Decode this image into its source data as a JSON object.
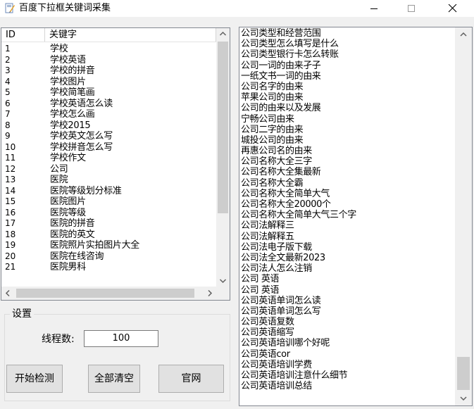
{
  "window": {
    "title": "百度下拉框关键词采集"
  },
  "list": {
    "columns": [
      "ID",
      "关键字"
    ],
    "rows": [
      {
        "id": "1",
        "keyword": "学校"
      },
      {
        "id": "2",
        "keyword": "学校英语"
      },
      {
        "id": "3",
        "keyword": "学校的拼音"
      },
      {
        "id": "4",
        "keyword": "学校图片"
      },
      {
        "id": "5",
        "keyword": "学校简笔画"
      },
      {
        "id": "6",
        "keyword": "学校英语怎么读"
      },
      {
        "id": "7",
        "keyword": "学校怎么画"
      },
      {
        "id": "8",
        "keyword": "学校2015"
      },
      {
        "id": "9",
        "keyword": "学校英文怎么写"
      },
      {
        "id": "10",
        "keyword": "学校拼音怎么写"
      },
      {
        "id": "11",
        "keyword": "学校作文"
      },
      {
        "id": "12",
        "keyword": "公司"
      },
      {
        "id": "13",
        "keyword": "医院"
      },
      {
        "id": "14",
        "keyword": "医院等级划分标准"
      },
      {
        "id": "15",
        "keyword": "医院图片"
      },
      {
        "id": "16",
        "keyword": "医院等级"
      },
      {
        "id": "17",
        "keyword": "医院的拼音"
      },
      {
        "id": "18",
        "keyword": "医院的英文"
      },
      {
        "id": "19",
        "keyword": "医院照片实拍图片大全"
      },
      {
        "id": "20",
        "keyword": "医院在线咨询"
      },
      {
        "id": "21",
        "keyword": "医院男科"
      }
    ]
  },
  "settings": {
    "group_title": "设置",
    "thread_label": "线程数:",
    "thread_value": "100",
    "start_button": "开始检测",
    "clear_button": "全部清空",
    "website_button": "官网"
  },
  "output_lines": [
    "公司类型和经营范围",
    "公司类型怎么填写是什么",
    "公司类型银行卡怎么转账",
    "公司一词的由来孑子",
    "一纸文书一词的由来",
    "公司名字的由来",
    "苹果公司的由来",
    "公司的由来以及发展",
    "宁畅公司由来",
    "公司二字的由来",
    "城投公司的由来",
    "再惠公司名的由来",
    "公司名称大全三字",
    "公司名称大全集最新",
    "公司名称大全霸",
    "公司名称大全简单大气",
    "公司名称大全20000个",
    "公司名称大全简单大气三个字",
    "公司法解释三",
    "公司法解释五",
    "公司法电子版下载",
    "公司法全文最新2023",
    "公司法人怎么注销",
    "公司 英语",
    "公司 英语",
    "公司英语单词怎么读",
    "公司英语单词怎么写",
    "公司英语复数",
    "公司英语缩写",
    "公司英语培训哪个好呢",
    "公司英语cor",
    "公司英语培训学费",
    "公司英语培训注意什么细节",
    "公司英语培训总结"
  ]
}
